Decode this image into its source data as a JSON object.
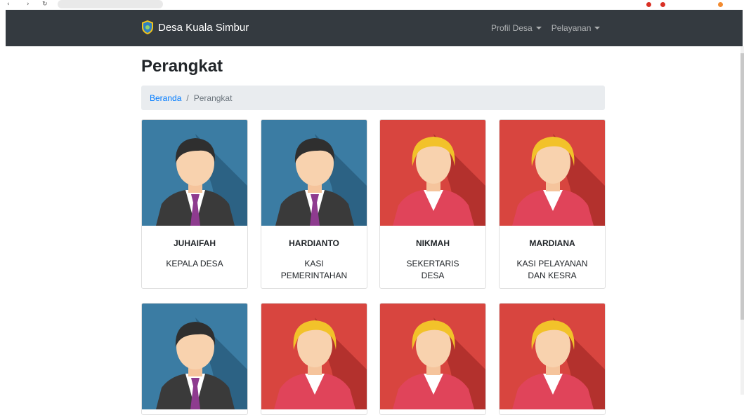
{
  "navbar": {
    "brand": "Desa Kuala Simbur",
    "menu": [
      {
        "label": "Profil Desa"
      },
      {
        "label": "Pelayanan"
      }
    ]
  },
  "page": {
    "title": "Perangkat",
    "breadcrumb": {
      "home": "Beranda",
      "separator": "/",
      "current": "Perangkat"
    }
  },
  "staff": [
    {
      "name": "JUHAIFAH",
      "role": "KEPALA DESA",
      "avatar": "male-avatar-icon"
    },
    {
      "name": "HARDIANTO",
      "role": "KASI PEMERINTAHAN",
      "avatar": "male-avatar-icon"
    },
    {
      "name": "NIKMAH",
      "role": "SEKERTARIS DESA",
      "avatar": "female-avatar-icon"
    },
    {
      "name": "MARDIANA",
      "role": "KASI PELAYANAN DAN KESRA",
      "avatar": "female-avatar-icon"
    },
    {
      "name": "",
      "role": "",
      "avatar": "male-avatar-icon"
    },
    {
      "name": "",
      "role": "",
      "avatar": "female-avatar-icon"
    },
    {
      "name": "",
      "role": "",
      "avatar": "female-avatar-icon"
    },
    {
      "name": "",
      "role": "",
      "avatar": "female-avatar-icon"
    }
  ],
  "colors": {
    "navbar": "#343a40",
    "link": "#007bff",
    "male_bg": "#3b7ca3",
    "female_bg": "#d8453f"
  }
}
